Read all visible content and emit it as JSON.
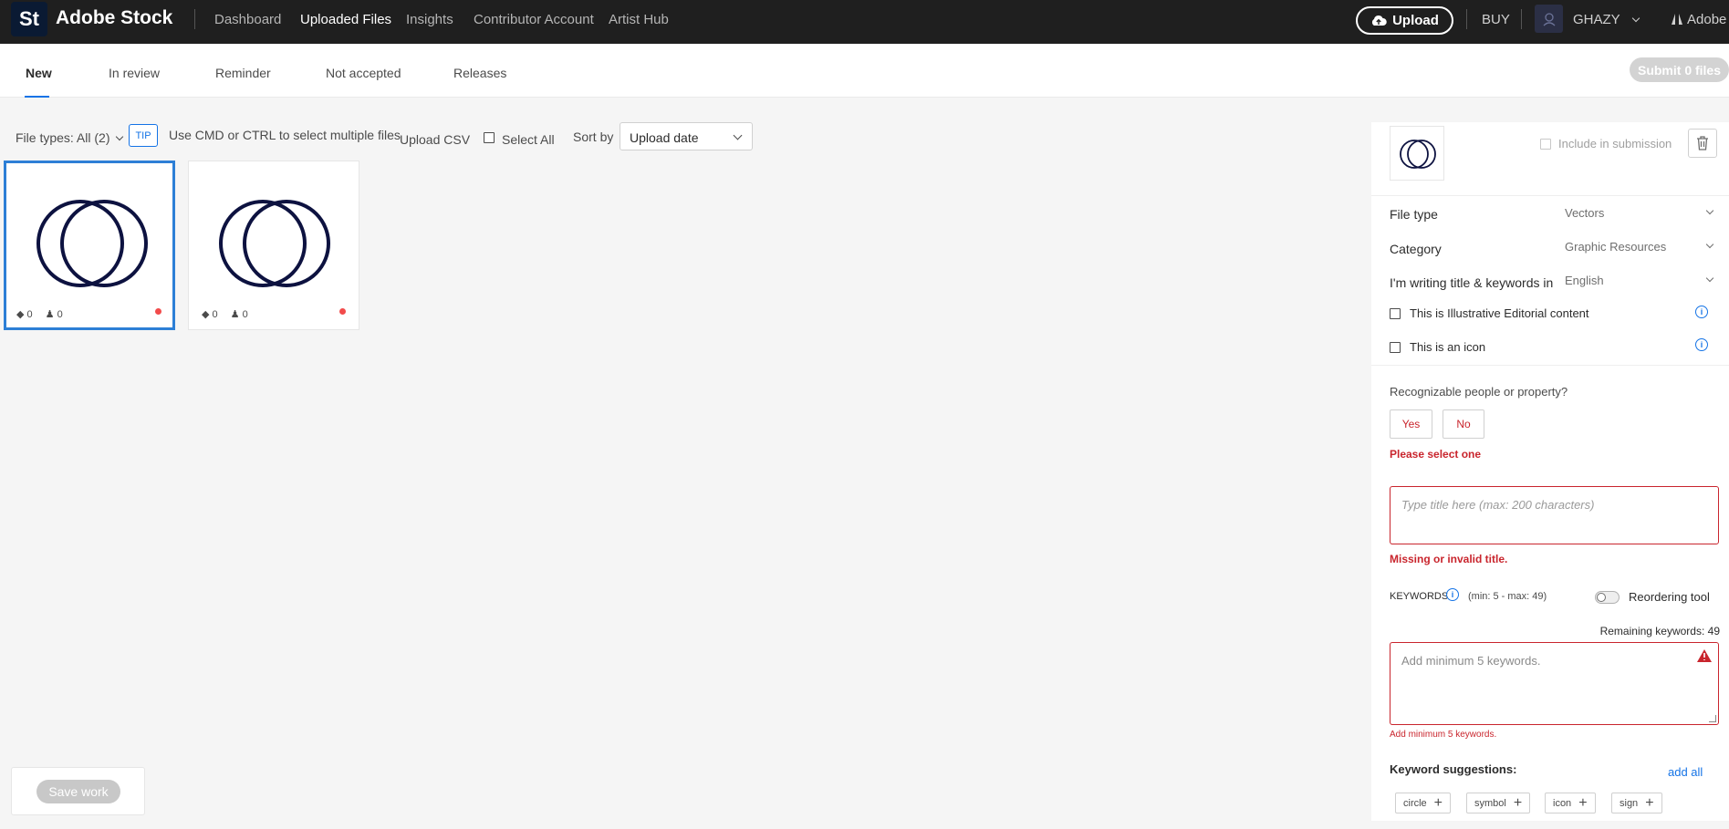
{
  "topbar": {
    "logo": "St",
    "brand": "Adobe Stock",
    "nav": [
      "Dashboard",
      "Uploaded Files",
      "Insights",
      "Contributor Account",
      "Artist Hub"
    ],
    "upload_label": "Upload",
    "buy_label": "BUY",
    "user_name": "GHAZY",
    "adobe_label": "Adobe"
  },
  "tabs": [
    "New",
    "In review",
    "Reminder",
    "Not accepted",
    "Releases"
  ],
  "submit_label": "Submit 0 files",
  "filters": {
    "file_types": "File types: All (2)",
    "tip_badge": "TIP",
    "tip_text": "Use CMD or CTRL to select multiple files",
    "upload_csv": "Upload CSV",
    "select_all": "Select All",
    "sort_by": "Sort by",
    "sort_value": "Upload date"
  },
  "cards": [
    {
      "keywords": "0",
      "releases": "0"
    },
    {
      "keywords": "0",
      "releases": "0"
    }
  ],
  "save_label": "Save work",
  "panel": {
    "include_label": "Include in submission",
    "file_type_label": "File type",
    "file_type_value": "Vectors",
    "category_label": "Category",
    "category_value": "Graphic Resources",
    "language_label": "I'm writing title & keywords in",
    "language_value": "English",
    "editorial_label": "This is Illustrative Editorial content",
    "icon_label": "This is an icon",
    "people_question": "Recognizable people or property?",
    "yes": "Yes",
    "no": "No",
    "select_error": "Please select one",
    "title_placeholder": "Type title here (max: 200 characters)",
    "title_error": "Missing or invalid title.",
    "keywords_label": "KEYWORDS",
    "keywords_range": "(min: 5 - max: 49)",
    "reorder_label": "Reordering tool",
    "remaining": "Remaining keywords: 49",
    "keywords_placeholder": "Add minimum 5 keywords.",
    "keywords_error": "Add minimum 5 keywords.",
    "suggestions_label": "Keyword suggestions:",
    "add_all": "add all",
    "suggestions": [
      "circle",
      "symbol",
      "icon",
      "sign"
    ]
  },
  "colors": {
    "accent": "#1473e6",
    "error": "#c9252d",
    "thumb_stroke": "#0d1240"
  }
}
